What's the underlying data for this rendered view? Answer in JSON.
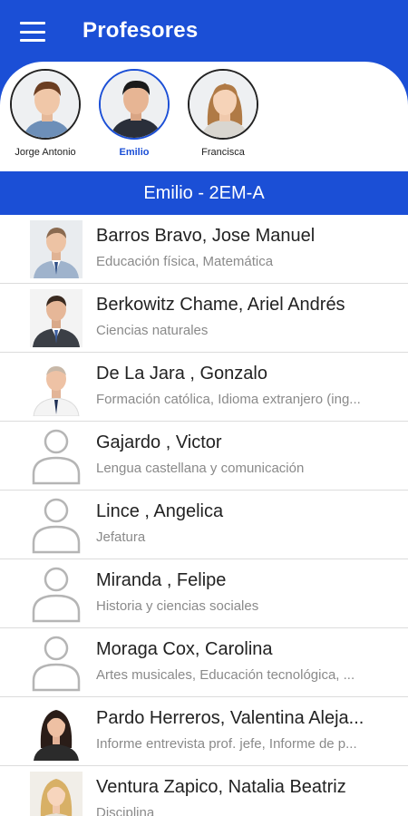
{
  "app_bar": {
    "title": "Profesores",
    "background": "#1b4fd6",
    "menu_icon": "hamburger-menu-icon"
  },
  "students": [
    {
      "name": "Jorge Antonio",
      "selected": false
    },
    {
      "name": "Emilio",
      "selected": true
    },
    {
      "name": "Francisca",
      "selected": false
    }
  ],
  "selection_bar": {
    "label": "Emilio - 2EM-A"
  },
  "teachers": [
    {
      "name": "Barros Bravo, Jose Manuel",
      "subjects": "Educación física, Matemática",
      "photo": "teacher-photo"
    },
    {
      "name": "Berkowitz Chame, Ariel Andrés",
      "subjects": "Ciencias naturales",
      "photo": "teacher-photo"
    },
    {
      "name": "De La Jara , Gonzalo",
      "subjects": "Formación católica, Idioma extranjero (ing...",
      "photo": "teacher-photo"
    },
    {
      "name": "Gajardo , Victor",
      "subjects": "Lengua castellana y comunicación",
      "photo": "default-user-icon"
    },
    {
      "name": "Lince , Angelica",
      "subjects": "Jefatura",
      "photo": "default-user-icon"
    },
    {
      "name": "Miranda , Felipe",
      "subjects": "Historia y ciencias sociales",
      "photo": "default-user-icon"
    },
    {
      "name": "Moraga Cox, Carolina",
      "subjects": "Artes musicales, Educación tecnológica, ...",
      "photo": "default-user-icon"
    },
    {
      "name": "Pardo Herreros, Valentina Aleja...",
      "subjects": "Informe entrevista prof. jefe, Informe de p...",
      "photo": "teacher-photo"
    },
    {
      "name": "Ventura Zapico, Natalia Beatriz",
      "subjects": "Disciplina",
      "photo": "teacher-photo"
    }
  ]
}
